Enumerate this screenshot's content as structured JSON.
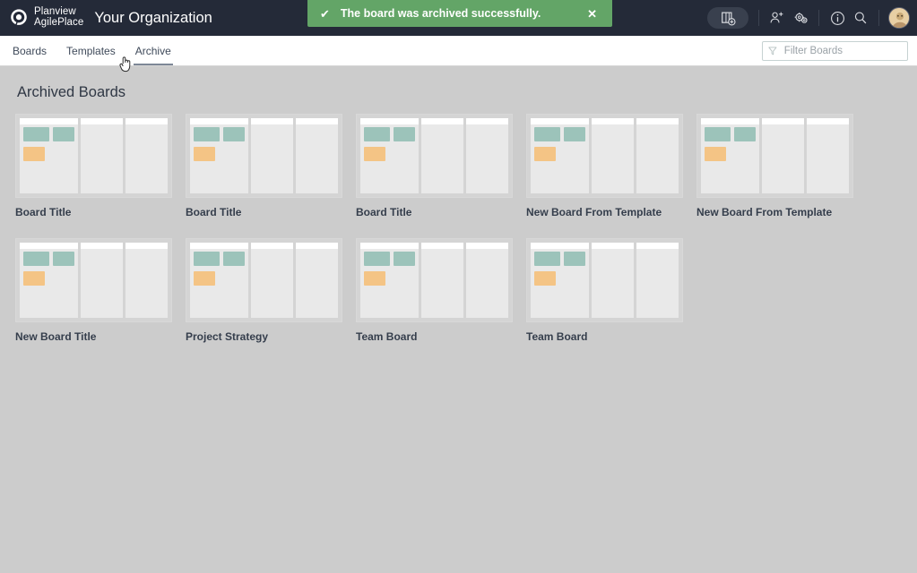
{
  "header": {
    "logo_line1": "Planview",
    "logo_line2": "AgilePlace",
    "org_title": "Your Organization",
    "icons": {
      "new_board": "new-board-icon",
      "add_user": "person-add-icon",
      "settings": "gears-icon",
      "info": "info-circle-icon",
      "search": "search-icon",
      "avatar": "user-avatar"
    },
    "colors": {
      "background": "#242a38",
      "new_board_button": "#39404e"
    }
  },
  "toast": {
    "message": "The board was archived successfully.",
    "check_icon": "checkmark-icon",
    "close_label": "✕",
    "color": "#63a567"
  },
  "subnav": {
    "tabs": [
      {
        "label": "Boards",
        "active": false
      },
      {
        "label": "Templates",
        "active": false
      },
      {
        "label": "Archive",
        "active": true
      }
    ],
    "filter": {
      "placeholder": "Filter Boards",
      "value": "",
      "icon": "filter-funnel-icon"
    }
  },
  "main": {
    "page_title": "Archived Boards",
    "background": "#cccccc",
    "boards": [
      {
        "name": "Board Title"
      },
      {
        "name": "Board Title"
      },
      {
        "name": "Board Title"
      },
      {
        "name": "New Board From Template"
      },
      {
        "name": "New Board From Template"
      },
      {
        "name": "New Board Title"
      },
      {
        "name": "Project Strategy"
      },
      {
        "name": "Team Board"
      },
      {
        "name": "Team Board"
      }
    ],
    "thumbnail_template": {
      "column_count": 3,
      "card_colors": {
        "teal": "#9cc3ba",
        "orange": "#f4c485"
      },
      "column_background": "#e9e9e9",
      "board_background": "#d4d4d4"
    }
  }
}
